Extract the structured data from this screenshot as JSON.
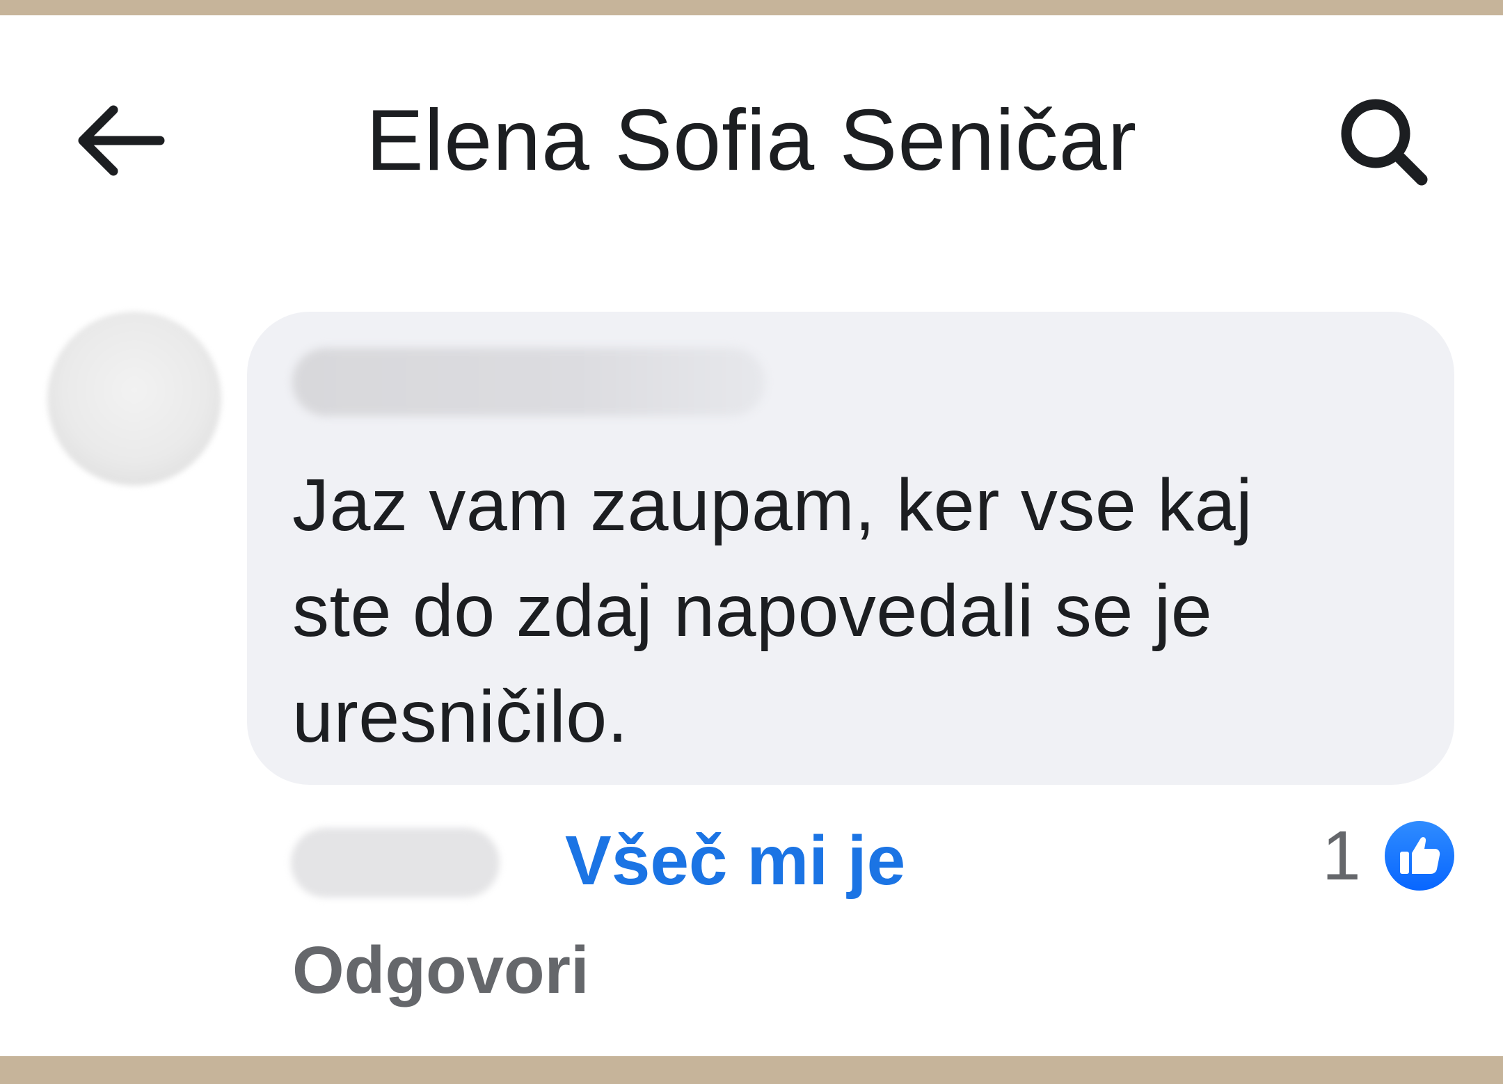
{
  "header": {
    "back_icon": "arrow-left-icon",
    "title": "Elena Sofia Seničar",
    "search_icon": "search-icon"
  },
  "comment": {
    "text": "Jaz vam zaupam, ker vse kaj\nste do zdaj napovedali se je\nuresničilo.",
    "actions": {
      "like_label": "Všeč mi je",
      "reply_label": "Odgovori"
    },
    "reactions": {
      "count": "1",
      "icon": "thumbs-up-icon"
    }
  },
  "colors": {
    "frame": "#c6b49a",
    "bubble": "#f0f1f5",
    "link_blue": "#1b74e4",
    "secondary_text": "#65676b",
    "primary_text": "#1c1e21"
  }
}
